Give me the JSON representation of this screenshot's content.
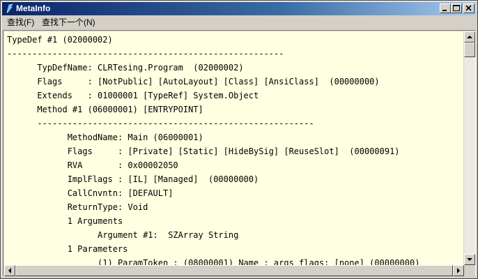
{
  "window": {
    "title": "MetaInfo",
    "controls": {
      "minimize": "minimize",
      "maximize": "maximize",
      "close": "close"
    }
  },
  "menu": [
    {
      "label": "查找(F)"
    },
    {
      "label": "查找下一个(N)"
    }
  ],
  "content": {
    "lines": [
      "TypeDef #1 (02000002)",
      "-------------------------------------------------------",
      "\tTypDefName: CLRTesing.Program  (02000002)",
      "\tFlags     : [NotPublic] [AutoLayout] [Class] [AnsiClass]  (00000000)",
      "\tExtends   : 01000001 [TypeRef] System.Object",
      "\tMethod #1 (06000001) [ENTRYPOINT]",
      "\t-------------------------------------------------------",
      "\t\tMethodName: Main (06000001)",
      "\t\tFlags     : [Private] [Static] [HideBySig] [ReuseSlot]  (00000091)",
      "\t\tRVA       : 0x00002050",
      "\t\tImplFlags : [IL] [Managed]  (00000000)",
      "\t\tCallCnvntn: [DEFAULT]",
      "\t\tReturnType: Void",
      "\t\t1 Arguments",
      "\t\t\tArgument #1:  SZArray String",
      "\t\t1 Parameters",
      "\t\t\t(1) ParamToken : (08000001) Name : args flags: [none] (00000000)"
    ]
  },
  "colors": {
    "text_background": "#ffffe1",
    "titlebar_start": "#0a246a",
    "titlebar_end": "#a6caf0"
  },
  "icons": {
    "app": "metainfo-app-icon",
    "scroll_up": "arrow-up-icon",
    "scroll_down": "arrow-down-icon",
    "scroll_left": "arrow-left-icon",
    "scroll_right": "arrow-right-icon"
  }
}
